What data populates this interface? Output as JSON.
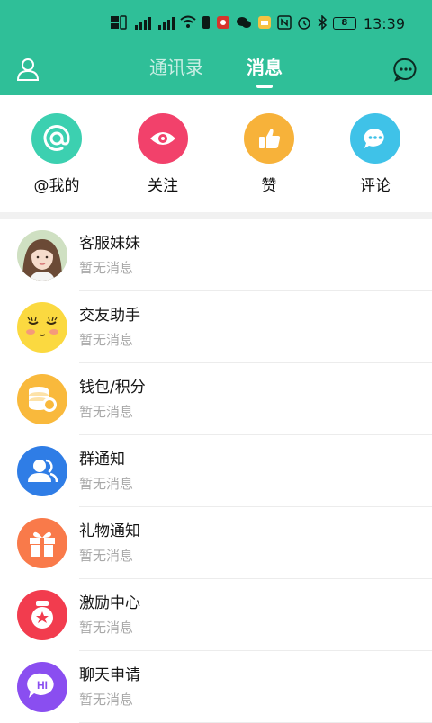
{
  "statusbar": {
    "time": "13:39",
    "battery": "8",
    "icons": [
      "hd-signal-icon",
      "signal-4g-icon",
      "signal-5g-icon",
      "wifi-icon",
      "sim-icon",
      "app-notification-icon",
      "wechat-icon",
      "notes-icon",
      "nfc-icon",
      "alarm-icon",
      "bluetooth-icon",
      "battery-icon"
    ]
  },
  "navbar": {
    "tabs": [
      {
        "label": "通讯录",
        "active": false
      },
      {
        "label": "消息",
        "active": true
      }
    ],
    "left_icon": "profile-icon",
    "right_icon": "chat-bubble-icon",
    "header_color": "#2fbf98"
  },
  "quick_actions": [
    {
      "label": "@我的",
      "icon": "at-icon",
      "color": "#3cd0b0"
    },
    {
      "label": "关注",
      "icon": "eye-icon",
      "color": "#f2416b"
    },
    {
      "label": "赞",
      "icon": "thumbs-up-icon",
      "color": "#f7b23a"
    },
    {
      "label": "评论",
      "icon": "comment-icon",
      "color": "#3fc2e8"
    }
  ],
  "messages": [
    {
      "title": "客服妹妹",
      "subtitle": "暂无消息",
      "icon": "customer-service-avatar"
    },
    {
      "title": "交友助手",
      "subtitle": "暂无消息",
      "icon": "smiley-face-icon",
      "color": "#fbd940"
    },
    {
      "title": "钱包/积分",
      "subtitle": "暂无消息",
      "icon": "coins-icon",
      "color": "#f9b93c"
    },
    {
      "title": "群通知",
      "subtitle": "暂无消息",
      "icon": "group-icon",
      "color": "#2f7de6"
    },
    {
      "title": "礼物通知",
      "subtitle": "暂无消息",
      "icon": "gift-icon",
      "color": "#f97a4a"
    },
    {
      "title": "激励中心",
      "subtitle": "暂无消息",
      "icon": "medal-icon",
      "color": "#f23c4e"
    },
    {
      "title": "聊天申请",
      "subtitle": "暂无消息",
      "icon": "hi-chat-icon",
      "color": "#8a4ef0"
    }
  ]
}
